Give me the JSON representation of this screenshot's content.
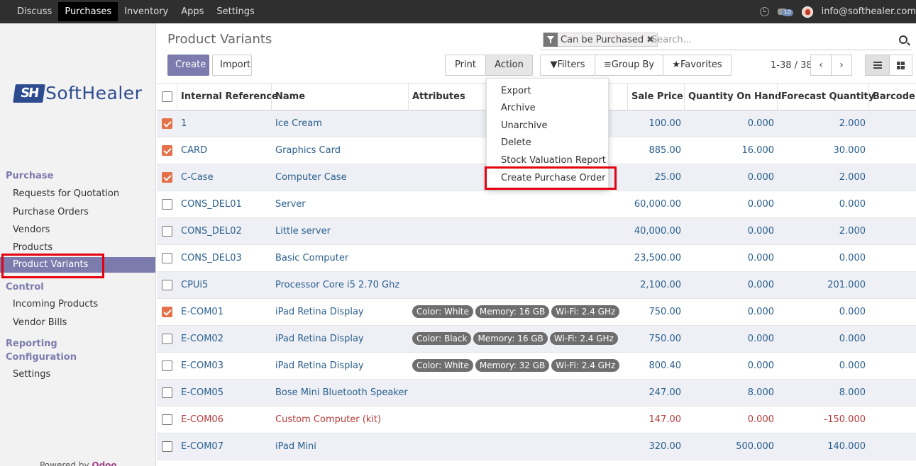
{
  "topbar": {
    "menu": [
      "Discuss",
      "Purchases",
      "Inventory",
      "Apps",
      "Settings"
    ],
    "active": "Purchases",
    "chat_badge": "10",
    "user_email": "info@softhealer.com"
  },
  "sidebar": {
    "logo_mark": "SH",
    "logo_word": "SoftHealer",
    "sections": {
      "purchase": "Purchase",
      "control": "Control",
      "reporting": "Reporting",
      "configuration": "Configuration"
    },
    "items": {
      "rfq": "Requests for Quotation",
      "purchase_orders": "Purchase Orders",
      "vendors": "Vendors",
      "products": "Products",
      "product_variants": "Product Variants",
      "incoming_products": "Incoming Products",
      "vendor_bills": "Vendor Bills",
      "settings": "Settings"
    },
    "powered_prefix": "Powered by",
    "powered_brand": "Odoo"
  },
  "page": {
    "title": "Product Variants",
    "create": "Create",
    "import": "Import",
    "print": "Print",
    "action": "Action",
    "filters": "Filters",
    "group_by": "Group By",
    "favorites": "Favorites",
    "pager": "1-38 / 38"
  },
  "search": {
    "facet": "Can be Purchased",
    "placeholder": "Search..."
  },
  "action_menu": [
    "Export",
    "Archive",
    "Unarchive",
    "Delete",
    "Stock Valuation Report",
    "Create Purchase Order"
  ],
  "columns": {
    "ref": "Internal Reference",
    "name": "Name",
    "attributes": "Attributes",
    "sale_price": "Sale Price",
    "qty_on_hand": "Quantity On Hand",
    "forecast": "Forecast Quantity",
    "barcode": "Barcode"
  },
  "rows": [
    {
      "ref": "1",
      "name": "Ice Cream",
      "price": "100.00",
      "qty": "0.000",
      "forecast": "2.000",
      "checked": true,
      "tags": []
    },
    {
      "ref": "CARD",
      "name": "Graphics Card",
      "price": "885.00",
      "qty": "16.000",
      "forecast": "30.000",
      "checked": true,
      "tags": []
    },
    {
      "ref": "C-Case",
      "name": "Computer Case",
      "price": "25.00",
      "qty": "0.000",
      "forecast": "2.000",
      "checked": true,
      "tags": []
    },
    {
      "ref": "CONS_DEL01",
      "name": "Server",
      "price": "60,000.00",
      "qty": "0.000",
      "forecast": "0.000",
      "checked": false,
      "tags": []
    },
    {
      "ref": "CONS_DEL02",
      "name": "Little server",
      "price": "40,000.00",
      "qty": "0.000",
      "forecast": "2.000",
      "checked": false,
      "tags": []
    },
    {
      "ref": "CONS_DEL03",
      "name": "Basic Computer",
      "price": "23,500.00",
      "qty": "0.000",
      "forecast": "0.000",
      "checked": false,
      "tags": []
    },
    {
      "ref": "CPUi5",
      "name": "Processor Core i5 2.70 Ghz",
      "price": "2,100.00",
      "qty": "0.000",
      "forecast": "201.000",
      "checked": false,
      "tags": []
    },
    {
      "ref": "E-COM01",
      "name": "iPad Retina Display",
      "price": "750.00",
      "qty": "0.000",
      "forecast": "0.000",
      "checked": true,
      "tags": [
        "Color: White",
        "Memory: 16 GB",
        "Wi-Fi: 2.4 GHz"
      ]
    },
    {
      "ref": "E-COM02",
      "name": "iPad Retina Display",
      "price": "750.00",
      "qty": "0.000",
      "forecast": "0.000",
      "checked": false,
      "tags": [
        "Color: Black",
        "Memory: 16 GB",
        "Wi-Fi: 2.4 GHz"
      ]
    },
    {
      "ref": "E-COM03",
      "name": "iPad Retina Display",
      "price": "800.40",
      "qty": "0.000",
      "forecast": "0.000",
      "checked": false,
      "tags": [
        "Color: White",
        "Memory: 32 GB",
        "Wi-Fi: 2.4 GHz"
      ]
    },
    {
      "ref": "E-COM05",
      "name": "Bose Mini Bluetooth Speaker",
      "price": "247.00",
      "qty": "8.000",
      "forecast": "8.000",
      "checked": false,
      "tags": []
    },
    {
      "ref": "E-COM06",
      "name": "Custom Computer (kit)",
      "price": "147.00",
      "qty": "0.000",
      "forecast": "-150.000",
      "checked": false,
      "danger": true,
      "tags": []
    },
    {
      "ref": "E-COM07",
      "name": "iPad Mini",
      "price": "320.00",
      "qty": "500.000",
      "forecast": "140.000",
      "checked": false,
      "tags": []
    }
  ]
}
